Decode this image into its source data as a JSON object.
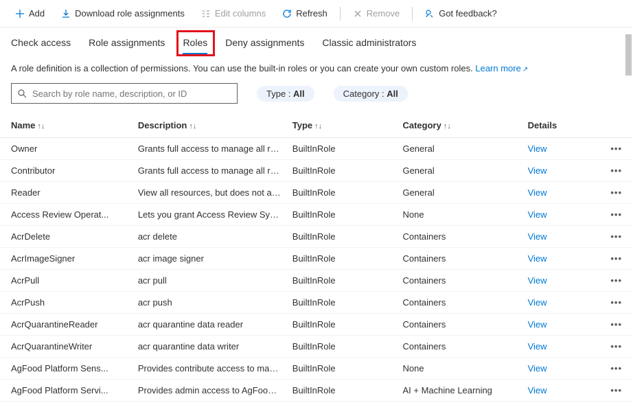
{
  "toolbar": {
    "add": "Add",
    "download": "Download role assignments",
    "edit_columns": "Edit columns",
    "refresh": "Refresh",
    "remove": "Remove",
    "feedback": "Got feedback?"
  },
  "tabs": {
    "check_access": "Check access",
    "role_assignments": "Role assignments",
    "roles": "Roles",
    "deny_assignments": "Deny assignments",
    "classic": "Classic administrators"
  },
  "description": {
    "text": "A role definition is a collection of permissions. You can use the built-in roles or you can create your own custom roles. ",
    "learn_more": "Learn more"
  },
  "search": {
    "placeholder": "Search by role name, description, or ID"
  },
  "filters": {
    "type_label": "Type : ",
    "type_value": "All",
    "category_label": "Category : ",
    "category_value": "All"
  },
  "columns": {
    "name": "Name",
    "description": "Description",
    "type": "Type",
    "category": "Category",
    "details": "Details"
  },
  "rows": [
    {
      "name": "Owner",
      "desc": "Grants full access to manage all res...",
      "type": "BuiltInRole",
      "cat": "General",
      "view": "View"
    },
    {
      "name": "Contributor",
      "desc": "Grants full access to manage all res...",
      "type": "BuiltInRole",
      "cat": "General",
      "view": "View"
    },
    {
      "name": "Reader",
      "desc": "View all resources, but does not all...",
      "type": "BuiltInRole",
      "cat": "General",
      "view": "View"
    },
    {
      "name": "Access Review Operat...",
      "desc": "Lets you grant Access Review Syste...",
      "type": "BuiltInRole",
      "cat": "None",
      "view": "View"
    },
    {
      "name": "AcrDelete",
      "desc": "acr delete",
      "type": "BuiltInRole",
      "cat": "Containers",
      "view": "View"
    },
    {
      "name": "AcrImageSigner",
      "desc": "acr image signer",
      "type": "BuiltInRole",
      "cat": "Containers",
      "view": "View"
    },
    {
      "name": "AcrPull",
      "desc": "acr pull",
      "type": "BuiltInRole",
      "cat": "Containers",
      "view": "View"
    },
    {
      "name": "AcrPush",
      "desc": "acr push",
      "type": "BuiltInRole",
      "cat": "Containers",
      "view": "View"
    },
    {
      "name": "AcrQuarantineReader",
      "desc": "acr quarantine data reader",
      "type": "BuiltInRole",
      "cat": "Containers",
      "view": "View"
    },
    {
      "name": "AcrQuarantineWriter",
      "desc": "acr quarantine data writer",
      "type": "BuiltInRole",
      "cat": "Containers",
      "view": "View"
    },
    {
      "name": "AgFood Platform Sens...",
      "desc": "Provides contribute access to man...",
      "type": "BuiltInRole",
      "cat": "None",
      "view": "View"
    },
    {
      "name": "AgFood Platform Servi...",
      "desc": "Provides admin access to AgFood ...",
      "type": "BuiltInRole",
      "cat": "AI + Machine Learning",
      "view": "View"
    }
  ]
}
